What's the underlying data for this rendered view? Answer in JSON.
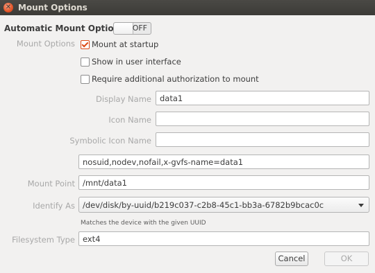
{
  "window": {
    "title": "Mount Options",
    "close_glyph": "✕"
  },
  "automatic": {
    "heading": "Automatic Mount Options",
    "toggle_state": "OFF"
  },
  "mount_options": {
    "label": "Mount Options",
    "checks": [
      {
        "label": "Mount at startup",
        "checked": true
      },
      {
        "label": "Show in user interface",
        "checked": false
      },
      {
        "label": "Require additional authorization to mount",
        "checked": false
      }
    ]
  },
  "display_name": {
    "label": "Display Name",
    "value": "data1"
  },
  "icon_name": {
    "label": "Icon Name",
    "value": ""
  },
  "symbolic_icon_name": {
    "label": "Symbolic Icon Name",
    "value": ""
  },
  "options_string": {
    "value": "nosuid,nodev,nofail,x-gvfs-name=data1"
  },
  "mount_point": {
    "label": "Mount Point",
    "value": "/mnt/data1"
  },
  "identify_as": {
    "label": "Identify As",
    "value": "/dev/disk/by-uuid/b219c037-c2b8-45c1-bb3a-6782b9bcac0c",
    "hint": "Matches the device with the given UUID"
  },
  "filesystem_type": {
    "label": "Filesystem Type",
    "value": "ext4"
  },
  "buttons": {
    "cancel": "Cancel",
    "ok": "OK"
  },
  "colors": {
    "accent": "#dd4814",
    "titlebar": "#3c3b37"
  }
}
